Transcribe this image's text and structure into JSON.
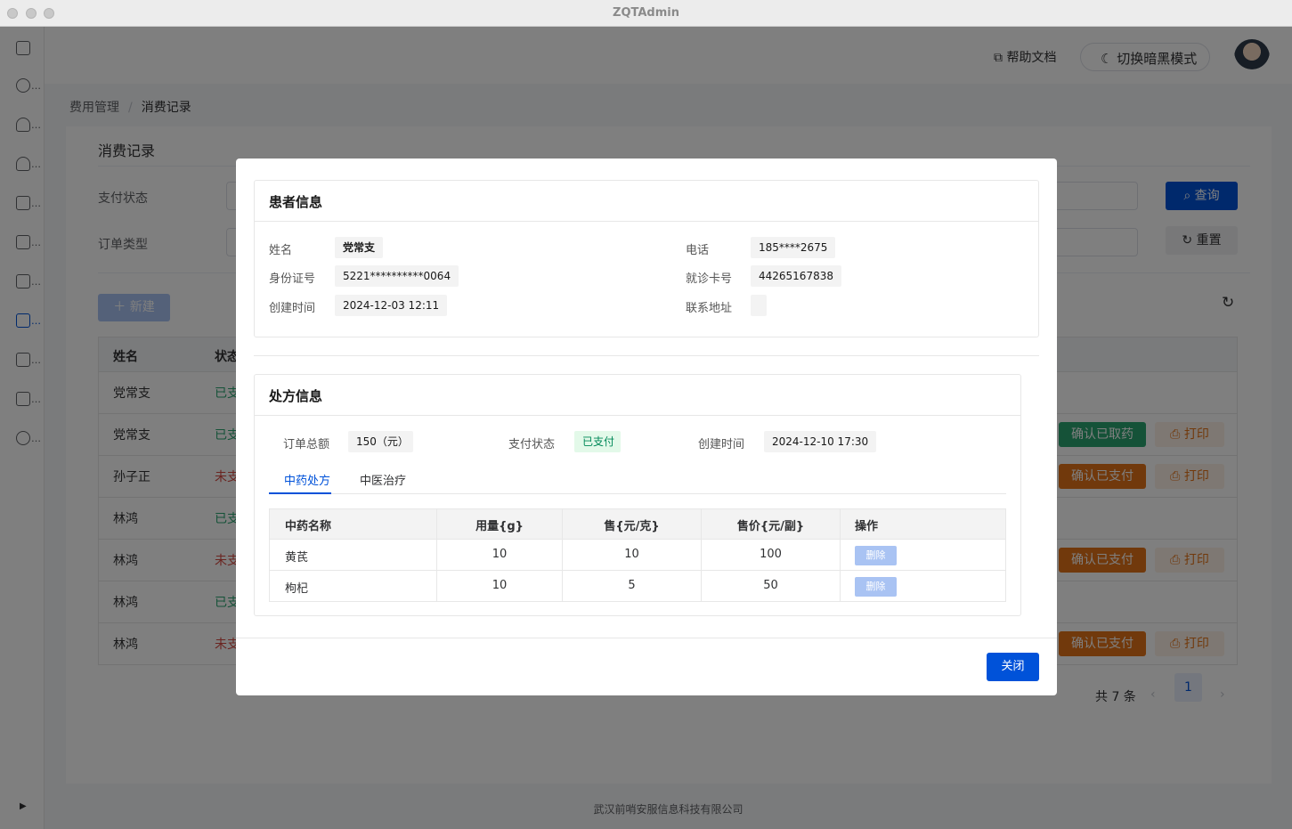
{
  "window": {
    "title": "ZQTAdmin"
  },
  "header": {
    "help_label": "帮助文档",
    "dark_mode_label": "切换暗黑模式"
  },
  "breadcrumb": {
    "parent": "费用管理",
    "current": "消费记录"
  },
  "page": {
    "title": "消费记录",
    "filters": {
      "pay_status_label": "支付状态",
      "order_type_label": "订单类型"
    },
    "query_label": "查询",
    "reset_label": "重置",
    "new_label": "新建",
    "table": {
      "headers": [
        "姓名",
        "状态"
      ],
      "rows": [
        {
          "name": "党常支",
          "status": "已支",
          "action": "",
          "print": ""
        },
        {
          "name": "党常支",
          "status": "已支",
          "action": "确认已取药",
          "print": "打印"
        },
        {
          "name": "孙子正",
          "status": "未支",
          "action": "确认已支付",
          "print": "打印"
        },
        {
          "name": "林鸿",
          "status": "已支",
          "action": "",
          "print": ""
        },
        {
          "name": "林鸿",
          "status": "未支",
          "action": "确认已支付",
          "print": "打印"
        },
        {
          "name": "林鸿",
          "status": "已支",
          "action": "",
          "print": ""
        },
        {
          "name": "林鸿",
          "status": "未支",
          "action": "确认已支付",
          "print": "打印"
        }
      ]
    },
    "pagination": {
      "total": "共 7 条",
      "current_page": "1"
    }
  },
  "footer": {
    "company": "武汉前哨安服信息科技有限公司"
  },
  "dialog": {
    "patient": {
      "title": "患者信息",
      "name_label": "姓名",
      "name": "党常支",
      "phone_label": "电话",
      "phone": "185****2675",
      "id_label": "身份证号",
      "id_number": "5221**********0064",
      "card_label": "就诊卡号",
      "card_number": "44265167838",
      "created_label": "创建时间",
      "created": "2024-12-03 12:11",
      "address_label": "联系地址",
      "address": ""
    },
    "prescription": {
      "title": "处方信息",
      "total_label": "订单总额",
      "total": "150（元）",
      "pay_label": "支付状态",
      "pay_status": "已支付",
      "created_label": "创建时间",
      "created": "2024-12-10 17:30",
      "tabs": [
        "中药处方",
        "中医治疗"
      ],
      "table": {
        "headers": [
          "中药名称",
          "用量{g}",
          "售{元/克}",
          "售价{元/副}",
          "操作"
        ],
        "rows": [
          {
            "name": "黄芪",
            "amount": "10",
            "unit_price": "10",
            "price": "100",
            "delete": "删除"
          },
          {
            "name": "枸杞",
            "amount": "10",
            "unit_price": "5",
            "price": "50",
            "delete": "删除"
          }
        ]
      }
    },
    "close_label": "关闭"
  },
  "colors": {
    "primary": "#0052d9",
    "success": "#2ba471",
    "warning": "#e37318",
    "danger": "#d54941"
  }
}
